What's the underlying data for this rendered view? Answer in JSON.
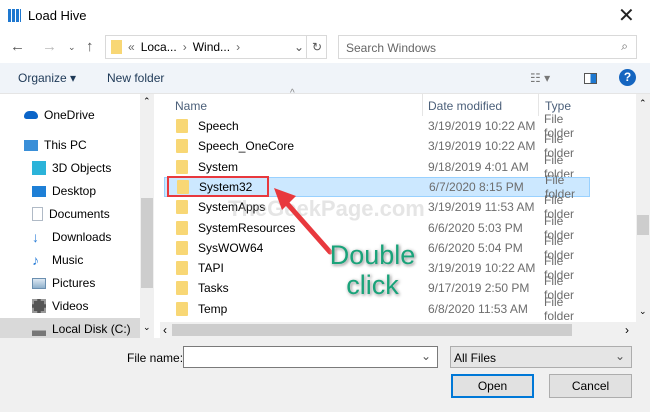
{
  "window": {
    "title": "Load Hive"
  },
  "nav": {
    "breadcrumb": [
      "Loca...",
      "Wind..."
    ],
    "search_placeholder": "Search Windows"
  },
  "toolbar": {
    "organize": "Organize ▾",
    "new_folder": "New folder"
  },
  "sidebar": {
    "items": [
      {
        "label": "OneDrive",
        "icon": "cloud-icon",
        "color": "#0a64c8"
      },
      {
        "label": "This PC",
        "icon": "computer-icon",
        "color": "#3a8fd8"
      },
      {
        "label": "3D Objects",
        "icon": "cube-icon",
        "color": "#2bb3d9"
      },
      {
        "label": "Desktop",
        "icon": "desktop-icon",
        "color": "#1e7fd6"
      },
      {
        "label": "Documents",
        "icon": "document-icon",
        "color": "#b0bac6"
      },
      {
        "label": "Downloads",
        "icon": "download-icon",
        "color": "#2d7fd8"
      },
      {
        "label": "Music",
        "icon": "music-icon",
        "color": "#2d7fd8"
      },
      {
        "label": "Pictures",
        "icon": "picture-icon",
        "color": "#6b8fb0"
      },
      {
        "label": "Videos",
        "icon": "video-icon",
        "color": "#555"
      },
      {
        "label": "Local Disk (C:)",
        "icon": "drive-icon",
        "color": "#777"
      }
    ]
  },
  "list": {
    "columns": [
      "Name",
      "Date modified",
      "Type"
    ],
    "rows": [
      {
        "name": "Speech",
        "date": "3/19/2019 10:22 AM",
        "type": "File folder"
      },
      {
        "name": "Speech_OneCore",
        "date": "3/19/2019 10:22 AM",
        "type": "File folder"
      },
      {
        "name": "System",
        "date": "9/18/2019 4:01 AM",
        "type": "File folder"
      },
      {
        "name": "System32",
        "date": "6/7/2020 8:15 PM",
        "type": "File folder"
      },
      {
        "name": "SystemApps",
        "date": "3/19/2019 11:53 AM",
        "type": "File folder"
      },
      {
        "name": "SystemResources",
        "date": "6/6/2020 5:03 PM",
        "type": "File folder"
      },
      {
        "name": "SysWOW64",
        "date": "6/6/2020 5:04 PM",
        "type": "File folder"
      },
      {
        "name": "TAPI",
        "date": "3/19/2019 10:22 AM",
        "type": "File folder"
      },
      {
        "name": "Tasks",
        "date": "9/17/2019 2:50 PM",
        "type": "File folder"
      },
      {
        "name": "Temp",
        "date": "6/8/2020 11:53 AM",
        "type": "File folder"
      }
    ]
  },
  "footer": {
    "file_name_label": "File name:",
    "file_name_value": "",
    "filter": "All Files",
    "open": "Open",
    "cancel": "Cancel"
  },
  "annotation": {
    "text_line1": "Double",
    "text_line2": "click",
    "watermark": "TheGeekPage.com",
    "color": "#e8383d",
    "text_color": "#1aa37a"
  }
}
